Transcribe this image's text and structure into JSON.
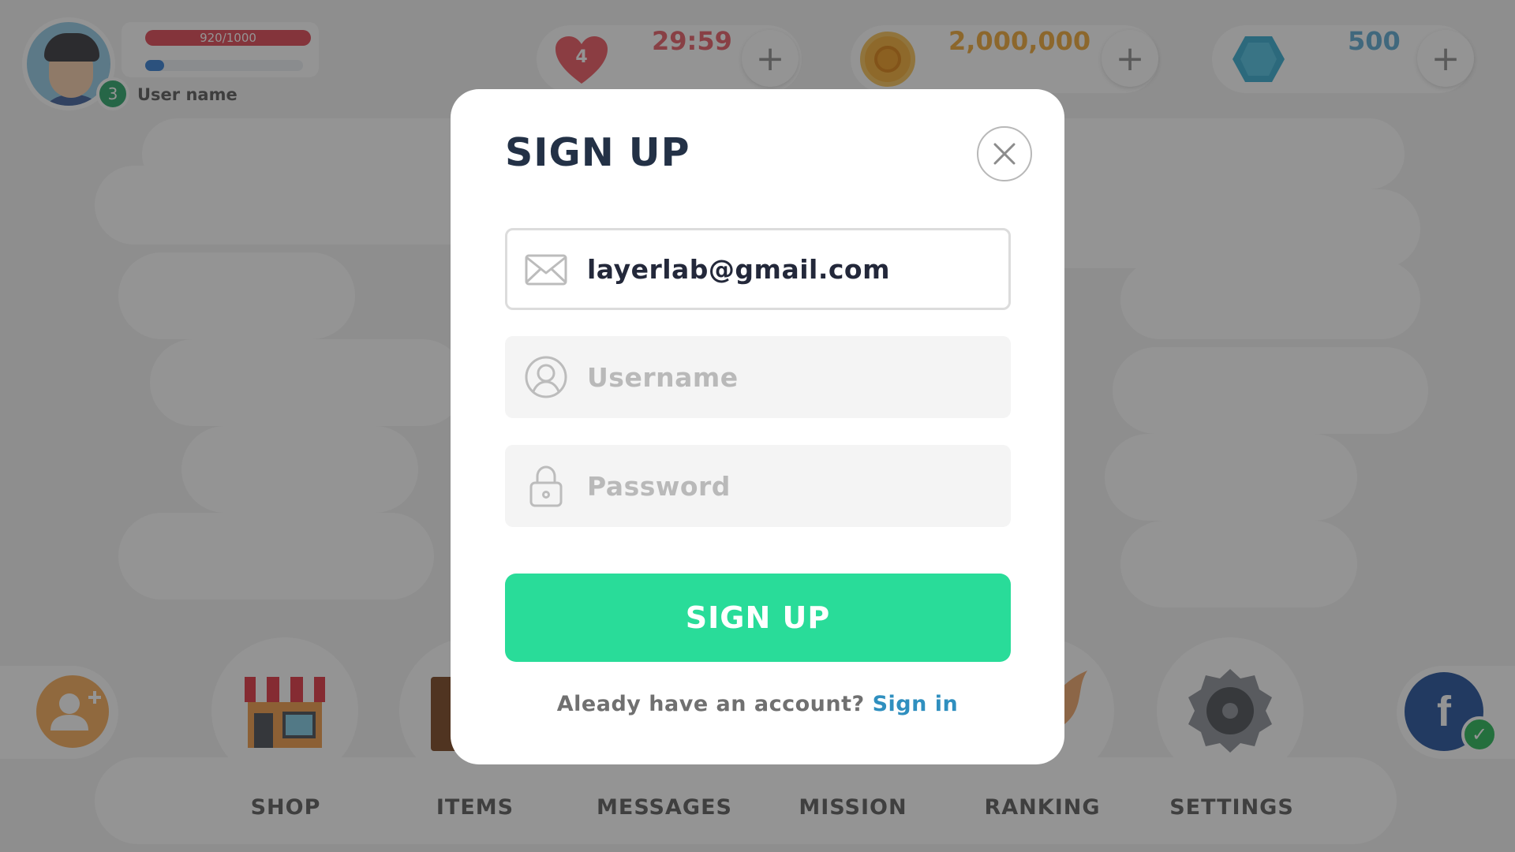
{
  "profile": {
    "xp": "920/1000",
    "level": "3",
    "username": "User name"
  },
  "resources": {
    "lives": "4",
    "timer": "29:59",
    "coins": "2,000,000",
    "gems": "500",
    "plus": "+"
  },
  "menu": {
    "items": [
      {
        "label": "SHOP"
      },
      {
        "label": "ITEMS"
      },
      {
        "label": "MESSAGES"
      },
      {
        "label": "MISSION"
      },
      {
        "label": "RANKING"
      },
      {
        "label": "SETTINGS"
      }
    ],
    "facebook": "f",
    "check": "✓"
  },
  "modal": {
    "title": "SIGN UP",
    "email_value": "layerlab@gmail.com",
    "username_placeholder": "Username",
    "password_placeholder": "Password",
    "submit_label": "SIGN UP",
    "footer_text": "Aleady have an account?",
    "footer_link": "Sign in"
  },
  "colors": {
    "accent": "#29dc99",
    "title": "#233146",
    "link": "#2f8fbf"
  }
}
